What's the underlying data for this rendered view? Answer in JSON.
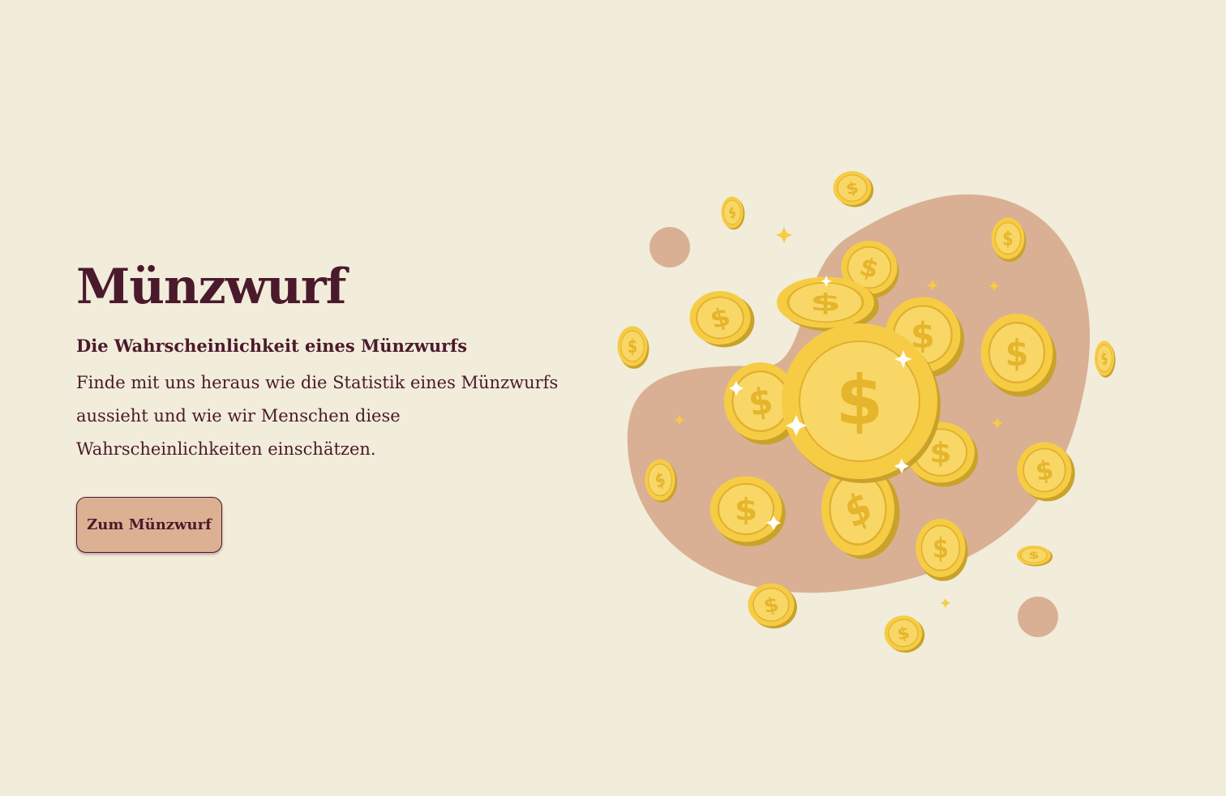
{
  "hero": {
    "title": "Münzwurf",
    "subtitle": "Die Wahrscheinlichkeit eines Münzwurfs",
    "description": "Finde mit uns heraus wie die Statistik eines Münzwurfs aussieht und wie wir Menschen diese Wahrscheinlichkeiten einschätzen.",
    "cta_label": "Zum Münzwurf"
  },
  "illustration": {
    "icon": "coins-illustration",
    "coin_glyph": "$"
  },
  "colors": {
    "background": "#f2ecda",
    "text": "#4a1a2c",
    "accent": "#dcb092",
    "coin": "#f7cc45",
    "coin_edge": "#c9a22a"
  }
}
